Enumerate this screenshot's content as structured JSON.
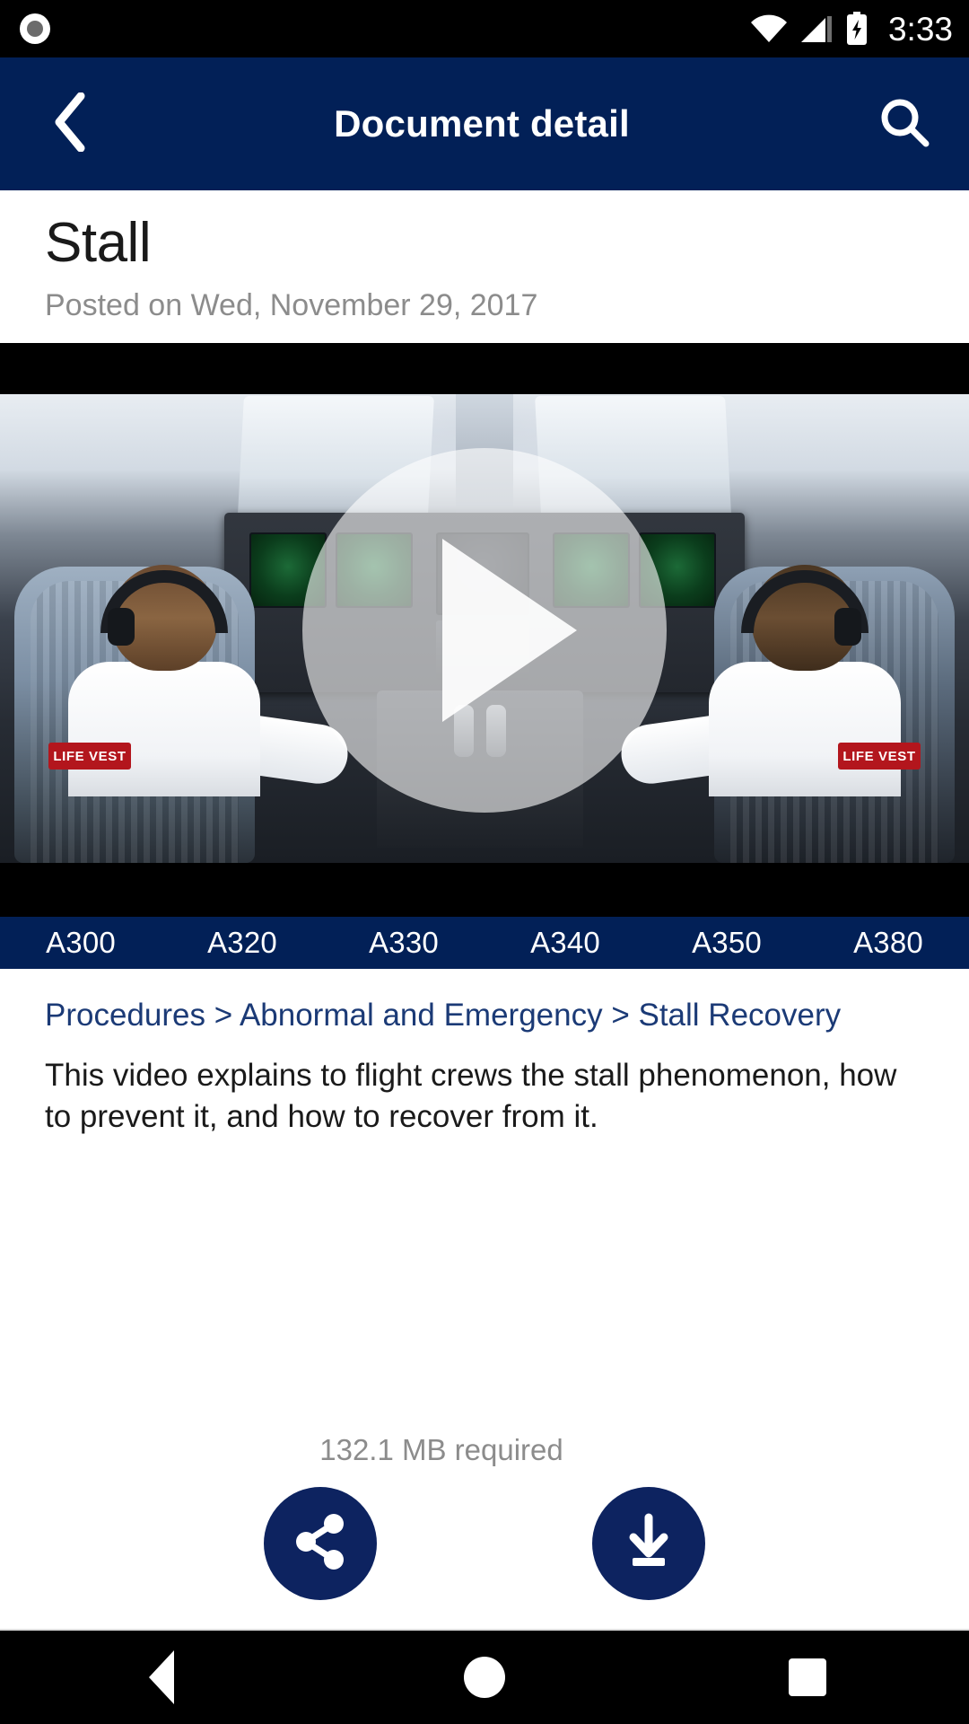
{
  "status_bar": {
    "camera_icon": "camera-dot-icon",
    "wifi_icon": "wifi-icon",
    "signal_icon": "cell-signal-icon",
    "battery_icon": "battery-charging-icon",
    "time": "3:33"
  },
  "app_bar": {
    "back_icon": "chevron-left-icon",
    "title": "Document detail",
    "search_icon": "search-icon",
    "background_color": "#022057"
  },
  "document": {
    "title": "Stall",
    "posted": "Posted on Wed, November 29, 2017",
    "breadcrumb": "Procedures > Abnormal and Emergency > Stall Recovery",
    "description": "This video explains to flight crews the stall phenomenon, how to prevent it, and how to recover from it."
  },
  "video": {
    "play_icon": "play-triangle-icon",
    "life_vest_label_left": "LIFE VEST",
    "life_vest_label_right": "LIFE VEST"
  },
  "aircraft_tags": [
    {
      "label": "A300"
    },
    {
      "label": "A320"
    },
    {
      "label": "A330"
    },
    {
      "label": "A340"
    },
    {
      "label": "A350"
    },
    {
      "label": "A380"
    }
  ],
  "footer": {
    "size_note": "132.1 MB required",
    "share_icon": "share-icon",
    "download_icon": "download-icon",
    "accent_color": "#0d2360"
  },
  "nav_bar": {
    "back_icon": "nav-back-triangle-icon",
    "home_icon": "nav-home-circle-icon",
    "recents_icon": "nav-recents-square-icon"
  }
}
